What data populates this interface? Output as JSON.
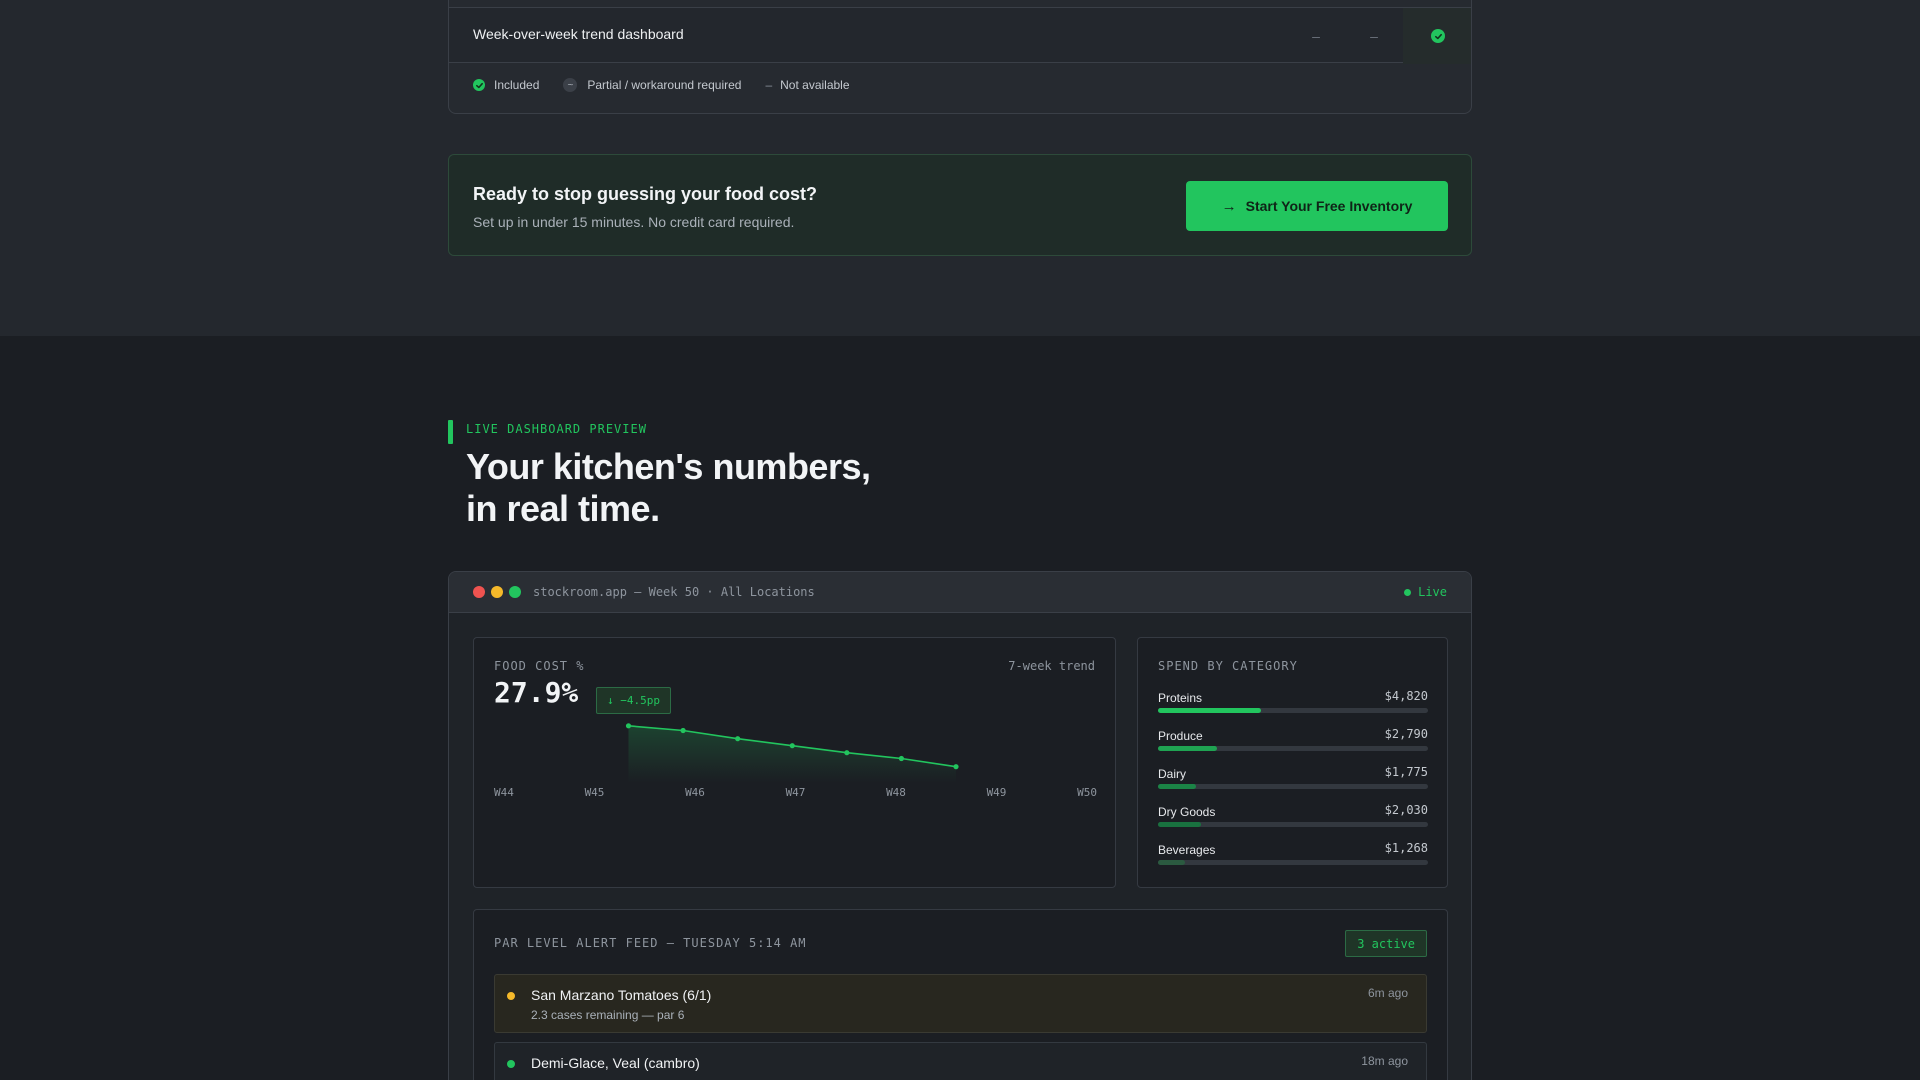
{
  "comparison": {
    "row": {
      "feature": "Week-over-week trend dashboard",
      "col1": "–",
      "col2": "–"
    },
    "legend": {
      "included": "Included",
      "partial_symbol": "~",
      "partial": "Partial / workaround required",
      "na_symbol": "–",
      "not_available": "Not available"
    }
  },
  "cta": {
    "title": "Ready to stop guessing your food cost?",
    "subtitle": "Set up in under 15 minutes. No credit card required.",
    "button_icon": "→",
    "button_label": "Start Your Free Inventory"
  },
  "section": {
    "eyebrow": "LIVE DASHBOARD PREVIEW",
    "headline_line1": "Your kitchen's numbers,",
    "headline_line2": "in real time."
  },
  "window": {
    "url": "stockroom.app — Week 50 · All Locations",
    "live_label": "Live"
  },
  "food_cost": {
    "label": "FOOD COST %",
    "value": "27.9%",
    "delta": "↓ −4.5pp",
    "trend_label": "7-week trend"
  },
  "chart_data": {
    "type": "line",
    "x": [
      "W44",
      "W45",
      "W46",
      "W47",
      "W48",
      "W49",
      "W50"
    ],
    "series": [
      {
        "values": [
          32.4,
          32.0,
          31.3,
          30.7,
          30.1,
          29.6,
          28.9
        ]
      }
    ],
    "ylim": [
      27.5,
      33.5
    ],
    "color": "#22c55e",
    "grid": false
  },
  "categories": {
    "label": "SPEND BY CATEGORY",
    "items": [
      {
        "name": "Proteins",
        "amount": "$4,820",
        "fill": 0.38,
        "color": "#22c55e"
      },
      {
        "name": "Produce",
        "amount": "$2,790",
        "fill": 0.22,
        "color": "#1fa352"
      },
      {
        "name": "Dairy",
        "amount": "$1,775",
        "fill": 0.14,
        "color": "#1b8446"
      },
      {
        "name": "Dry Goods",
        "amount": "$2,030",
        "fill": 0.16,
        "color": "#19713f"
      },
      {
        "name": "Beverages",
        "amount": "$1,268",
        "fill": 0.1,
        "color": "#2b5a40"
      }
    ]
  },
  "alerts": {
    "label": "PAR LEVEL ALERT FEED — TUESDAY 5:14 AM",
    "badge": "3 active",
    "items": [
      {
        "title": "San Marzano Tomatoes (6/1)",
        "sub": "2.3 cases remaining — par 6",
        "time": "6m ago",
        "status_color": "#f5b92a"
      },
      {
        "title": "Demi-Glace, Veal (cambro)",
        "sub": "",
        "time": "18m ago",
        "status_color": "#22c55e"
      }
    ]
  },
  "colors": {
    "accent": "#22c55e",
    "warning": "#f5b92a",
    "close": "#ef5350"
  }
}
